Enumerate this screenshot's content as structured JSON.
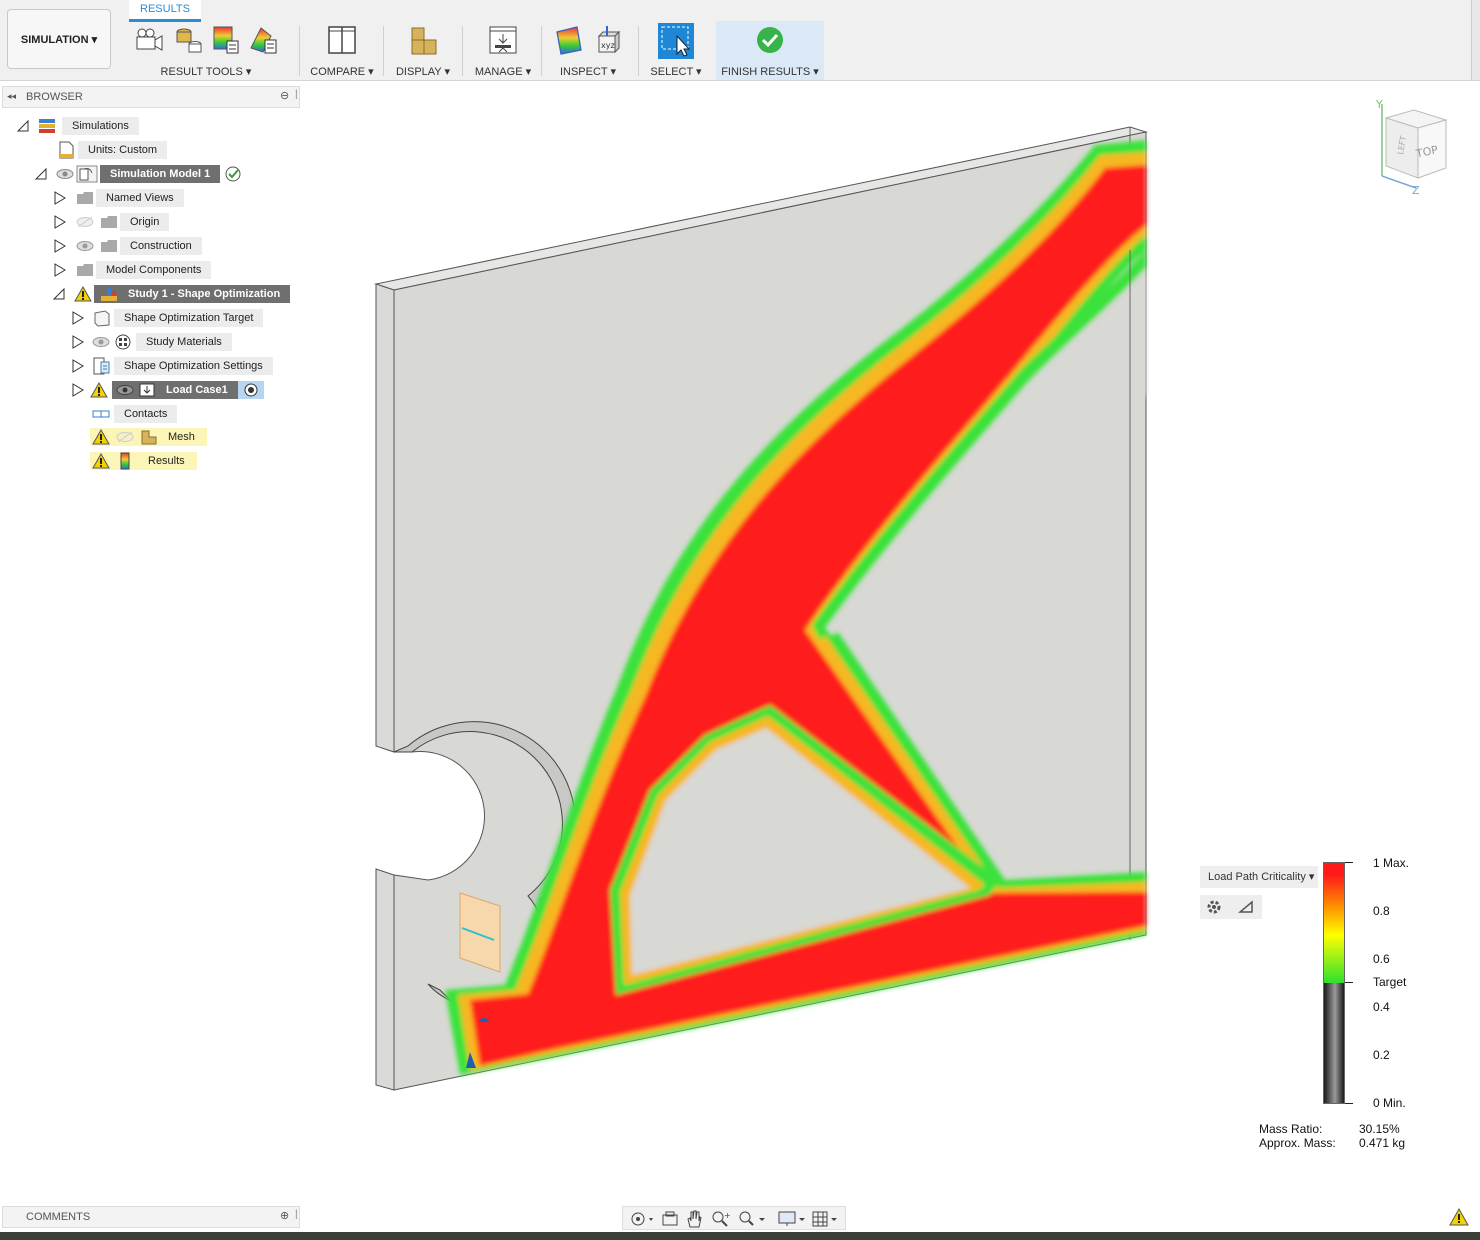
{
  "toolbar": {
    "workspace": "SIMULATION ▾",
    "active_tab": "RESULTS",
    "groups": {
      "result_tools": "RESULT TOOLS ▾",
      "compare": "COMPARE ▾",
      "display": "DISPLAY ▾",
      "manage": "MANAGE ▾",
      "inspect": "INSPECT ▾",
      "select": "SELECT ▾",
      "finish": "FINISH RESULTS ▾"
    }
  },
  "browser": {
    "title": "BROWSER",
    "items": [
      {
        "label": "Simulations"
      },
      {
        "label": "Units: Custom"
      },
      {
        "label": "Simulation Model 1"
      },
      {
        "label": "Named Views"
      },
      {
        "label": "Origin"
      },
      {
        "label": "Construction"
      },
      {
        "label": "Model Components"
      },
      {
        "label": "Study 1 - Shape Optimization"
      },
      {
        "label": "Shape Optimization Target"
      },
      {
        "label": "Study Materials"
      },
      {
        "label": "Shape Optimization Settings"
      },
      {
        "label": "Load Case1"
      },
      {
        "label": "Contacts"
      },
      {
        "label": "Mesh"
      },
      {
        "label": "Results"
      }
    ]
  },
  "viewcube": {
    "face_top": "TOP",
    "face_left": "LEFT",
    "axis_y": "Y",
    "axis_z": "Z"
  },
  "legend": {
    "result_type": "Load Path Criticality ▾",
    "labels": [
      "1 Max.",
      "0.8",
      "0.6",
      "Target",
      "0.4",
      "0.2",
      "0 Min."
    ],
    "colors": {
      "max": "#ff1a1a",
      "mid": "#ffff00",
      "target": "#2fe02f",
      "below": "#1a1a1a"
    }
  },
  "stats": {
    "mass_ratio_label": "Mass Ratio:",
    "mass_ratio_value": "30.15%",
    "approx_mass_label": "Approx. Mass:",
    "approx_mass_value": "0.471 kg"
  },
  "comments": {
    "title": "COMMENTS"
  }
}
